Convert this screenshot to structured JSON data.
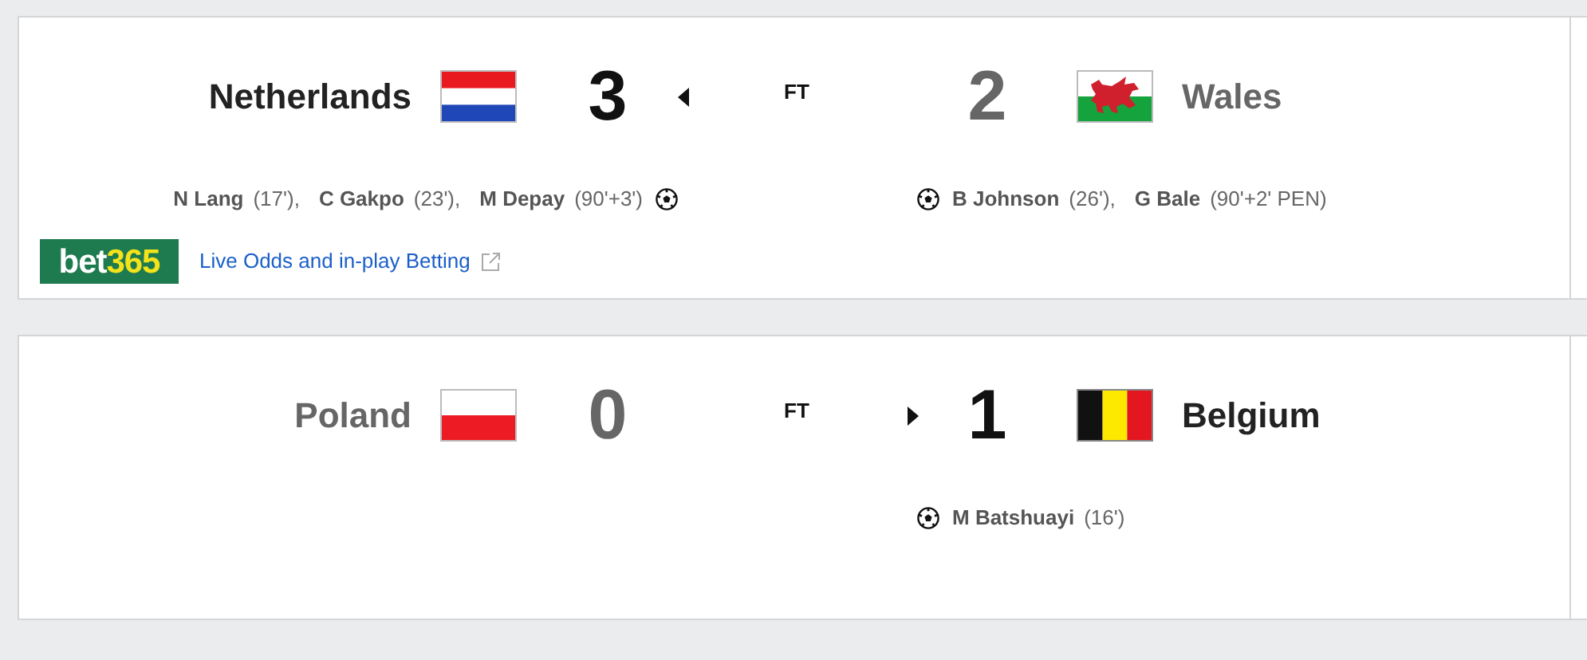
{
  "matches": [
    {
      "status": "FT",
      "home": {
        "name": "Netherlands",
        "flag": {
          "kind": "netherlands"
        },
        "score": "3",
        "winner": true,
        "scorers": [
          {
            "name": "N Lang",
            "minute": "(17'),"
          },
          {
            "name": "C Gakpo",
            "minute": "(23'),"
          },
          {
            "name": "M Depay",
            "minute": "(90'+3')"
          }
        ]
      },
      "away": {
        "name": "Wales",
        "flag": {
          "kind": "wales"
        },
        "score": "2",
        "winner": false,
        "scorers": [
          {
            "name": "B Johnson",
            "minute": "(26'),"
          },
          {
            "name": "G Bale",
            "minute": "(90'+2' PEN)"
          }
        ]
      },
      "betting": {
        "logo": [
          "bet",
          "365"
        ],
        "link": "Live Odds and in-play Betting"
      }
    },
    {
      "status": "FT",
      "home": {
        "name": "Poland",
        "flag": {
          "kind": "poland"
        },
        "score": "0",
        "winner": false
      },
      "away": {
        "name": "Belgium",
        "flag": {
          "kind": "belgium"
        },
        "score": "1",
        "winner": true,
        "scorers": [
          {
            "name": "M Batshuayi",
            "minute": "(16')"
          }
        ]
      }
    }
  ]
}
